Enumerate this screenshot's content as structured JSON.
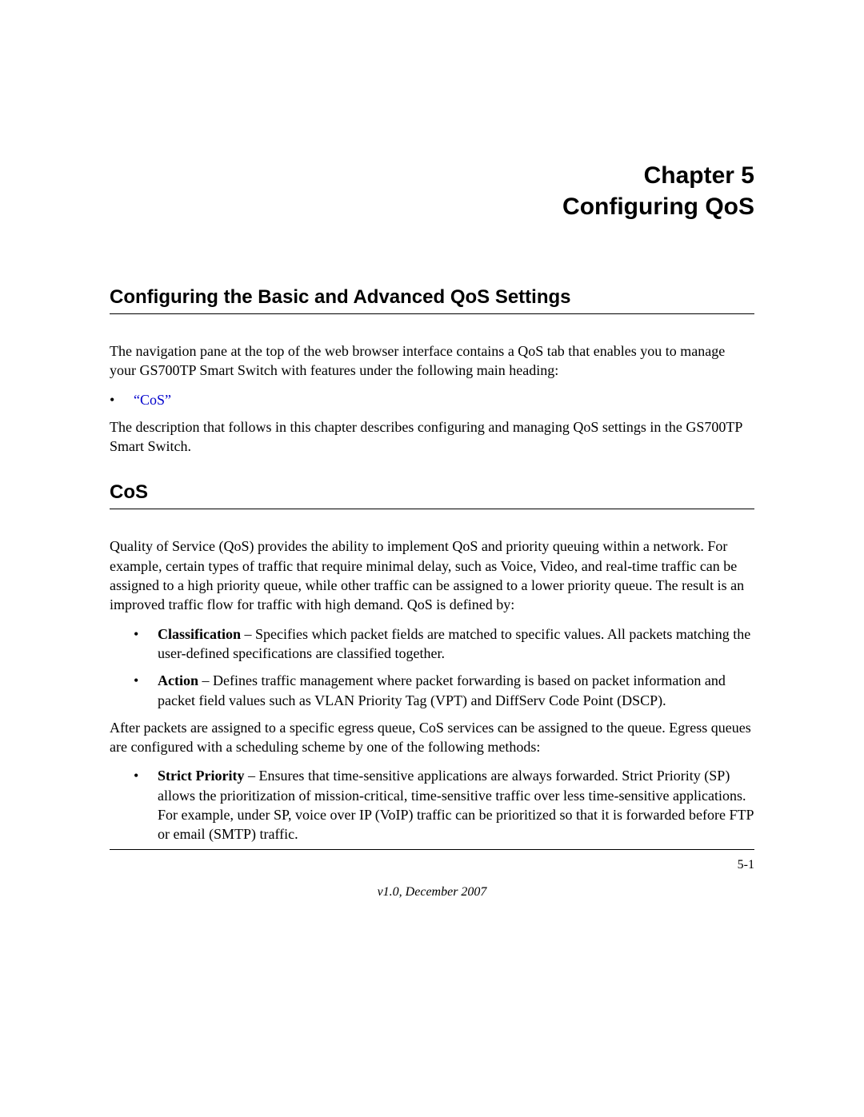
{
  "chapter": {
    "line1": "Chapter 5",
    "line2": "Configuring QoS"
  },
  "section1": {
    "heading": "Configuring the Basic and Advanced QoS Settings",
    "para1": "The navigation pane at the top of the web browser interface contains a QoS tab that enables you to manage your GS700TP Smart Switch with features under the following main heading:",
    "bullet1_link": "“CoS”",
    "para2": "The description that follows in this chapter describes configuring and managing QoS settings in the GS700TP Smart Switch."
  },
  "section2": {
    "heading": "CoS",
    "para1": "Quality of Service (QoS) provides the ability to implement QoS and priority queuing within a network. For example, certain types of traffic that require minimal delay, such as Voice, Video, and real-time traffic can be assigned to a high priority queue, while other traffic can be assigned to a lower priority queue. The result is an improved traffic flow for traffic with high demand. QoS is defined by:",
    "bullet1_term": "Classification",
    "bullet1_text": " – Specifies which packet fields are matched to specific values. All packets matching the user-defined specifications are classified together.",
    "bullet2_term": "Action",
    "bullet2_text": " – Defines traffic management where packet forwarding is based on packet information and packet field values such as VLAN Priority Tag (VPT) and DiffServ Code Point (DSCP).",
    "para2": "After packets are assigned to a specific egress queue, CoS services can be assigned to the queue. Egress queues are configured with a scheduling scheme by one of the following methods:",
    "bullet3_term": "Strict Priority",
    "bullet3_text": " – Ensures that time-sensitive applications are always forwarded. Strict Priority (SP) allows the prioritization of mission-critical, time-sensitive traffic over less time-sensitive applications. For example, under SP, voice over IP (VoIP) traffic can be prioritized so that it is forwarded before FTP or email (SMTP) traffic."
  },
  "footer": {
    "page_number": "5-1",
    "version": "v1.0, December 2007"
  },
  "bullet_char": "•"
}
